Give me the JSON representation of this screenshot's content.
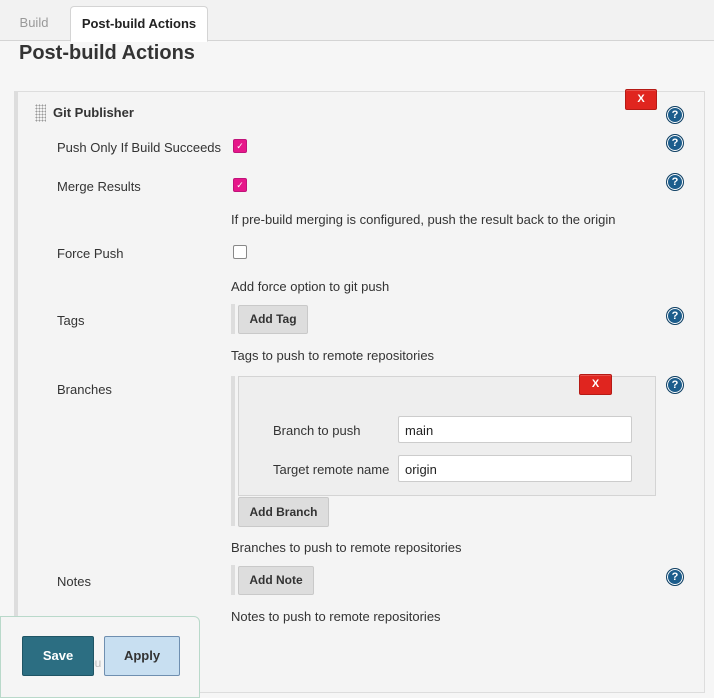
{
  "tabs": [
    {
      "label": "Build"
    },
    {
      "label": "Post-build Actions"
    }
  ],
  "page_title": "Post-build Actions",
  "section": {
    "title": "Git Publisher",
    "delete_label": "X",
    "help_glyph": "?"
  },
  "fields": {
    "push_only": {
      "label": "Push Only If Build Succeeds",
      "checked": true
    },
    "merge_results": {
      "label": "Merge Results",
      "checked": true,
      "description": "If pre-build merging is configured, push the result back to the origin"
    },
    "force_push": {
      "label": "Force Push",
      "checked": false,
      "description": "Add force option to git push"
    },
    "tags": {
      "label": "Tags",
      "button": "Add Tag",
      "description": "Tags to push to remote repositories"
    },
    "branches": {
      "label": "Branches",
      "delete_label": "X",
      "branch_to_push_label": "Branch to push",
      "branch_to_push_value": "main",
      "target_remote_label": "Target remote name",
      "target_remote_value": "origin",
      "button": "Add Branch",
      "description": "Branches to push to remote repositories"
    },
    "notes": {
      "label": "Notes",
      "button": "Add Note",
      "description": "Notes to push to remote repositories"
    }
  },
  "footer": {
    "save": "Save",
    "apply": "Apply",
    "obscured_text": "ou"
  },
  "colors": {
    "checkbox_checked": "#e6178a",
    "delete_button": "#e0251f",
    "save_button": "#2c6e82",
    "help_icon": "#1c5d8c"
  }
}
